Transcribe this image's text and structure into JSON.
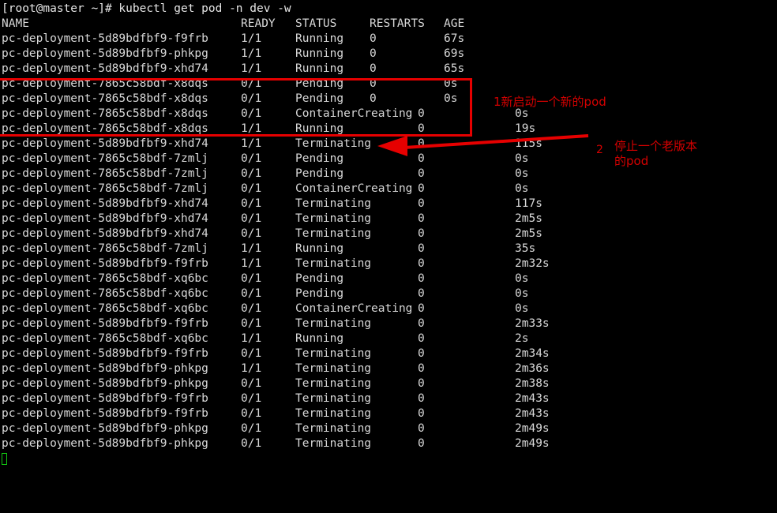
{
  "terminal": {
    "prompt": "[root@master ~]# ",
    "command": "kubectl get pod -n dev -w",
    "prompt_line": "[root@master ~]# kubectl get pod -n dev -w",
    "cursor_color": "#12c912"
  },
  "table": {
    "headers": {
      "name": "NAME",
      "ready": "READY",
      "status": "STATUS",
      "restarts": "RESTARTS",
      "age": "AGE"
    },
    "rows": [
      {
        "name": "pc-deployment-5d89bdfbf9-f9frb",
        "ready": "1/1",
        "status": "Running",
        "restarts": "0",
        "age": "67s",
        "width": "narrow"
      },
      {
        "name": "pc-deployment-5d89bdfbf9-phkpg",
        "ready": "1/1",
        "status": "Running",
        "restarts": "0",
        "age": "69s",
        "width": "narrow"
      },
      {
        "name": "pc-deployment-5d89bdfbf9-xhd74",
        "ready": "1/1",
        "status": "Running",
        "restarts": "0",
        "age": "65s",
        "width": "narrow"
      },
      {
        "name": "pc-deployment-7865c58bdf-x8dqs",
        "ready": "0/1",
        "status": "Pending",
        "restarts": "0",
        "age": "0s",
        "width": "narrow"
      },
      {
        "name": "pc-deployment-7865c58bdf-x8dqs",
        "ready": "0/1",
        "status": "Pending",
        "restarts": "0",
        "age": "0s",
        "width": "narrow"
      },
      {
        "name": "pc-deployment-7865c58bdf-x8dqs",
        "ready": "0/1",
        "status": "ContainerCreating",
        "restarts": "0",
        "age": "0s",
        "width": "wide"
      },
      {
        "name": "pc-deployment-7865c58bdf-x8dqs",
        "ready": "1/1",
        "status": "Running",
        "restarts": "0",
        "age": "19s",
        "width": "wide"
      },
      {
        "name": "pc-deployment-5d89bdfbf9-xhd74",
        "ready": "1/1",
        "status": "Terminating",
        "restarts": "0",
        "age": "115s",
        "width": "wide"
      },
      {
        "name": "pc-deployment-7865c58bdf-7zmlj",
        "ready": "0/1",
        "status": "Pending",
        "restarts": "0",
        "age": "0s",
        "width": "wide"
      },
      {
        "name": "pc-deployment-7865c58bdf-7zmlj",
        "ready": "0/1",
        "status": "Pending",
        "restarts": "0",
        "age": "0s",
        "width": "wide"
      },
      {
        "name": "pc-deployment-7865c58bdf-7zmlj",
        "ready": "0/1",
        "status": "ContainerCreating",
        "restarts": "0",
        "age": "0s",
        "width": "wide"
      },
      {
        "name": "pc-deployment-5d89bdfbf9-xhd74",
        "ready": "0/1",
        "status": "Terminating",
        "restarts": "0",
        "age": "117s",
        "width": "wide"
      },
      {
        "name": "pc-deployment-5d89bdfbf9-xhd74",
        "ready": "0/1",
        "status": "Terminating",
        "restarts": "0",
        "age": "2m5s",
        "width": "wide"
      },
      {
        "name": "pc-deployment-5d89bdfbf9-xhd74",
        "ready": "0/1",
        "status": "Terminating",
        "restarts": "0",
        "age": "2m5s",
        "width": "wide"
      },
      {
        "name": "pc-deployment-7865c58bdf-7zmlj",
        "ready": "1/1",
        "status": "Running",
        "restarts": "0",
        "age": "35s",
        "width": "wide"
      },
      {
        "name": "pc-deployment-5d89bdfbf9-f9frb",
        "ready": "1/1",
        "status": "Terminating",
        "restarts": "0",
        "age": "2m32s",
        "width": "wide"
      },
      {
        "name": "pc-deployment-7865c58bdf-xq6bc",
        "ready": "0/1",
        "status": "Pending",
        "restarts": "0",
        "age": "0s",
        "width": "wide"
      },
      {
        "name": "pc-deployment-7865c58bdf-xq6bc",
        "ready": "0/1",
        "status": "Pending",
        "restarts": "0",
        "age": "0s",
        "width": "wide"
      },
      {
        "name": "pc-deployment-7865c58bdf-xq6bc",
        "ready": "0/1",
        "status": "ContainerCreating",
        "restarts": "0",
        "age": "0s",
        "width": "wide"
      },
      {
        "name": "pc-deployment-5d89bdfbf9-f9frb",
        "ready": "0/1",
        "status": "Terminating",
        "restarts": "0",
        "age": "2m33s",
        "width": "wide"
      },
      {
        "name": "pc-deployment-7865c58bdf-xq6bc",
        "ready": "1/1",
        "status": "Running",
        "restarts": "0",
        "age": "2s",
        "width": "wide"
      },
      {
        "name": "pc-deployment-5d89bdfbf9-f9frb",
        "ready": "0/1",
        "status": "Terminating",
        "restarts": "0",
        "age": "2m34s",
        "width": "wide"
      },
      {
        "name": "pc-deployment-5d89bdfbf9-phkpg",
        "ready": "1/1",
        "status": "Terminating",
        "restarts": "0",
        "age": "2m36s",
        "width": "wide"
      },
      {
        "name": "pc-deployment-5d89bdfbf9-phkpg",
        "ready": "0/1",
        "status": "Terminating",
        "restarts": "0",
        "age": "2m38s",
        "width": "wide"
      },
      {
        "name": "pc-deployment-5d89bdfbf9-f9frb",
        "ready": "0/1",
        "status": "Terminating",
        "restarts": "0",
        "age": "2m43s",
        "width": "wide"
      },
      {
        "name": "pc-deployment-5d89bdfbf9-f9frb",
        "ready": "0/1",
        "status": "Terminating",
        "restarts": "0",
        "age": "2m43s",
        "width": "wide"
      },
      {
        "name": "pc-deployment-5d89bdfbf9-phkpg",
        "ready": "0/1",
        "status": "Terminating",
        "restarts": "0",
        "age": "2m49s",
        "width": "wide"
      },
      {
        "name": "pc-deployment-5d89bdfbf9-phkpg",
        "ready": "0/1",
        "status": "Terminating",
        "restarts": "0",
        "age": "2m49s",
        "width": "wide"
      }
    ]
  },
  "annotations": {
    "color": "#d40000",
    "note1": {
      "number": "1",
      "text": "新启动一个新的pod"
    },
    "note2": {
      "number": "2",
      "line1": "停止一个老版本",
      "line2": "的pod"
    }
  }
}
